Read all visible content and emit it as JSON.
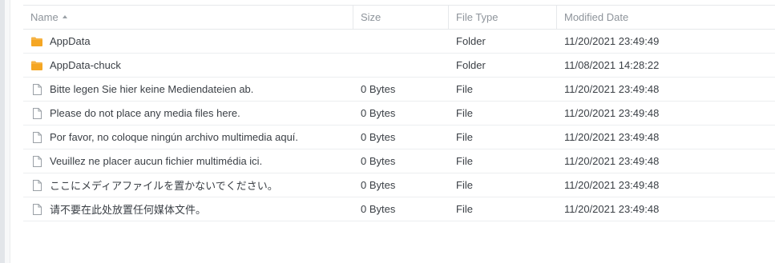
{
  "header": {
    "name": "Name",
    "size": "Size",
    "type": "File Type",
    "modified": "Modified Date"
  },
  "colors": {
    "folder": "#f5a623",
    "file_outline": "#9aa0a6"
  },
  "rows": [
    {
      "icon": "folder-icon",
      "name": "AppData",
      "size": "",
      "type": "Folder",
      "modified": "11/20/2021 23:49:49"
    },
    {
      "icon": "folder-icon",
      "name": "AppData-chuck",
      "size": "",
      "type": "Folder",
      "modified": "11/08/2021 14:28:22"
    },
    {
      "icon": "file-icon",
      "name": "Bitte legen Sie hier keine Mediendateien ab.",
      "size": "0 Bytes",
      "type": "File",
      "modified": "11/20/2021 23:49:48"
    },
    {
      "icon": "file-icon",
      "name": "Please do not place any media files here.",
      "size": "0 Bytes",
      "type": "File",
      "modified": "11/20/2021 23:49:48"
    },
    {
      "icon": "file-icon",
      "name": "Por favor, no coloque ningún archivo multimedia aquí.",
      "size": "0 Bytes",
      "type": "File",
      "modified": "11/20/2021 23:49:48"
    },
    {
      "icon": "file-icon",
      "name": "Veuillez ne placer aucun fichier multimédia ici.",
      "size": "0 Bytes",
      "type": "File",
      "modified": "11/20/2021 23:49:48"
    },
    {
      "icon": "file-icon",
      "name": "ここにメディアファイルを置かないでください。",
      "size": "0 Bytes",
      "type": "File",
      "modified": "11/20/2021 23:49:48"
    },
    {
      "icon": "file-icon",
      "name": "请不要在此处放置任何媒体文件。",
      "size": "0 Bytes",
      "type": "File",
      "modified": "11/20/2021 23:49:48"
    }
  ]
}
